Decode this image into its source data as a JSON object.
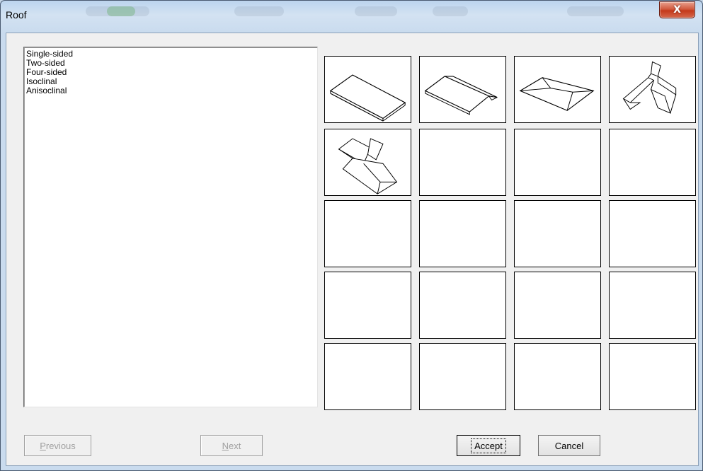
{
  "window": {
    "title": "Roof",
    "close_label": "X"
  },
  "list": {
    "items": [
      "Single-sided",
      "Two-sided",
      "Four-sided",
      "Isoclinal",
      "Anisoclinal"
    ]
  },
  "grid": {
    "rows": 5,
    "cols": 4,
    "cells": [
      {
        "icon": "single-sided-roof-icon"
      },
      {
        "icon": "two-sided-roof-icon"
      },
      {
        "icon": "four-sided-roof-icon"
      },
      {
        "icon": "isoclinal-roof-icon"
      },
      {
        "icon": "anisoclinal-roof-icon"
      },
      {
        "icon": ""
      },
      {
        "icon": ""
      },
      {
        "icon": ""
      },
      {
        "icon": ""
      },
      {
        "icon": ""
      },
      {
        "icon": ""
      },
      {
        "icon": ""
      },
      {
        "icon": ""
      },
      {
        "icon": ""
      },
      {
        "icon": ""
      },
      {
        "icon": ""
      },
      {
        "icon": ""
      },
      {
        "icon": ""
      },
      {
        "icon": ""
      },
      {
        "icon": ""
      }
    ]
  },
  "buttons": {
    "previous": {
      "accel": "P",
      "rest": "revious"
    },
    "next": {
      "accel": "N",
      "rest": "ext"
    },
    "accept": "Accept",
    "cancel": "Cancel"
  },
  "colors": {
    "close_button": "#c9482a",
    "title_bar": "#c9dbee",
    "dialog_bg": "#f0f0f0"
  }
}
